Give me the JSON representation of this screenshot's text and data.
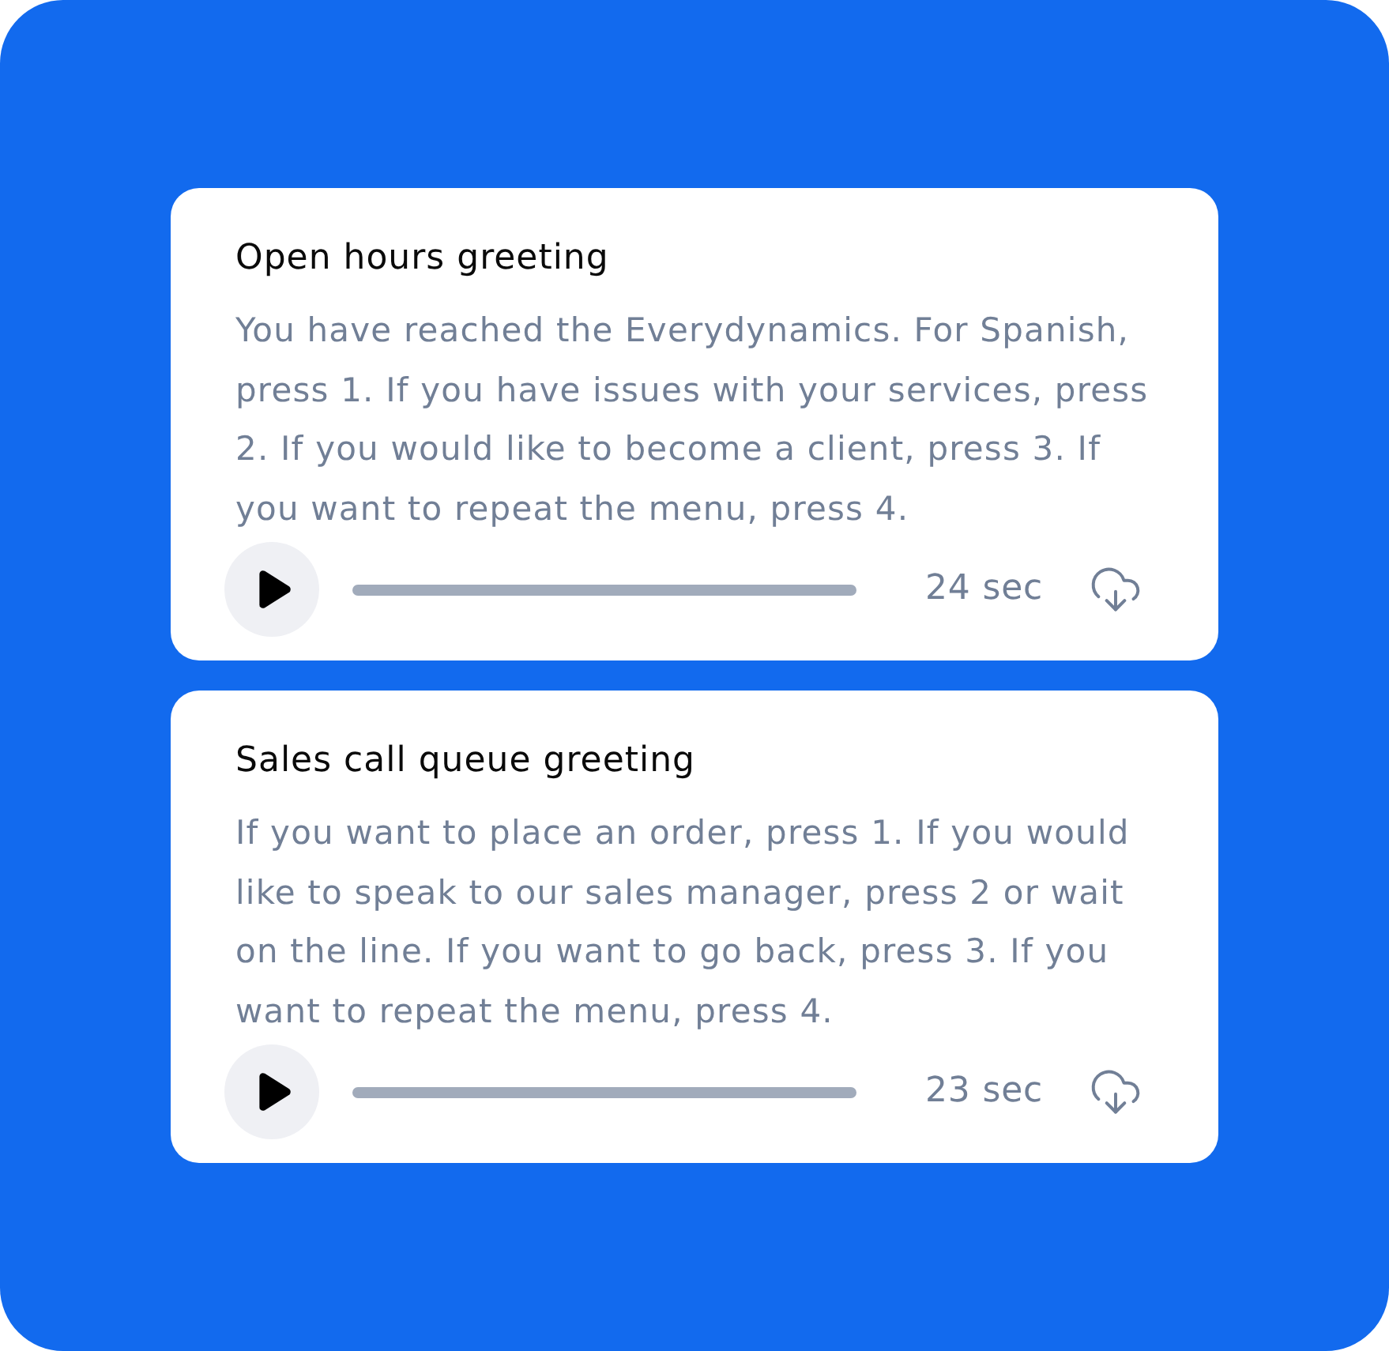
{
  "greetings": [
    {
      "title": "Open hours greeting",
      "message": "You have reached the Everydynamics. For Spanish, press 1. If you have issues with your services, press 2. If you would like to become a client, press 3. If you want to repeat the menu, press 4.",
      "player": {
        "playing": false,
        "duration": "24 sec"
      }
    },
    {
      "title": "Sales call queue greeting",
      "message": "If you want to place an order, press 1. If you would like to speak to our sales manager, press 2 or wait on the line. If you want to go back, press 3. If you want to repeat the menu, press 4.",
      "player": {
        "playing": false,
        "duration": "23 sec"
      }
    }
  ]
}
